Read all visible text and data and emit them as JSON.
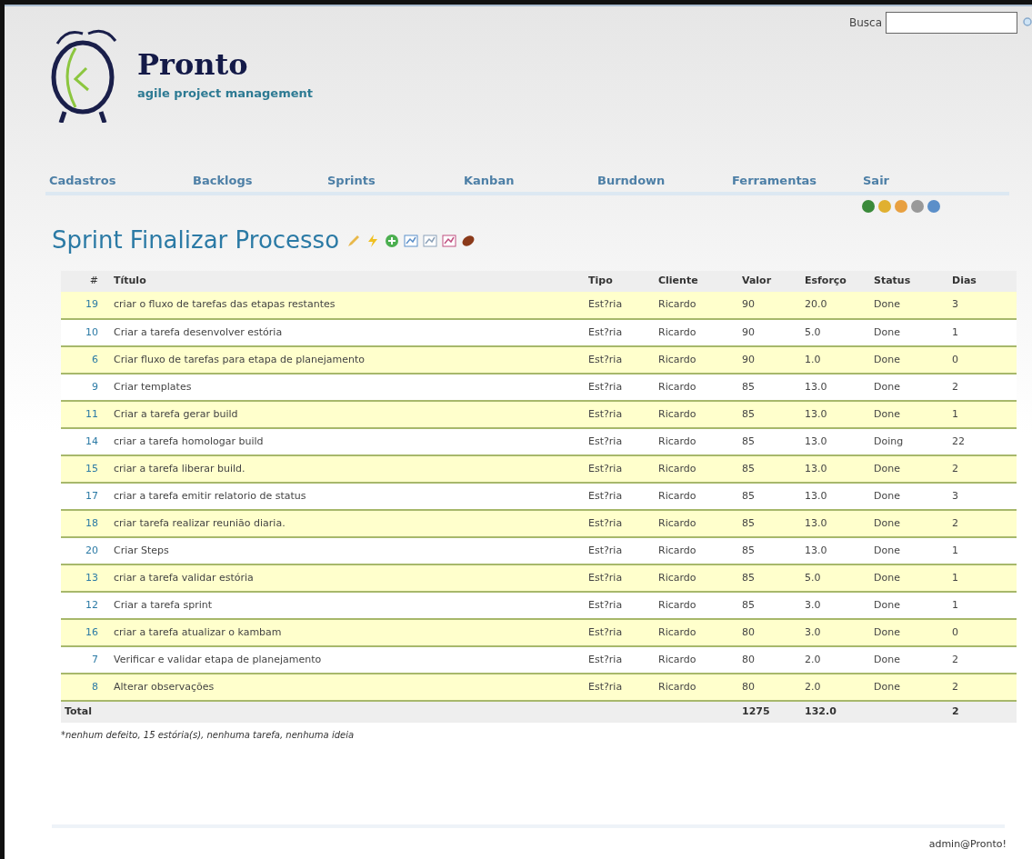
{
  "search": {
    "label": "Busca"
  },
  "logo": {
    "name": "Pronto",
    "tagline": "agile project management"
  },
  "nav": [
    "Cadastros",
    "Backlogs",
    "Sprints",
    "Kanban",
    "Burndown",
    "Ferramentas",
    "Sair"
  ],
  "title": "Sprint Finalizar Processo",
  "table": {
    "columns": [
      "#",
      "Título",
      "Tipo",
      "Cliente",
      "Valor",
      "Esforço",
      "Status",
      "Dias"
    ],
    "rows": [
      [
        "19",
        "criar o fluxo de tarefas das etapas restantes",
        "Est?ria",
        "Ricardo",
        "90",
        "20.0",
        "Done",
        "3"
      ],
      [
        "10",
        "Criar a tarefa desenvolver estória",
        "Est?ria",
        "Ricardo",
        "90",
        "5.0",
        "Done",
        "1"
      ],
      [
        "6",
        "Criar fluxo de tarefas para etapa de planejamento",
        "Est?ria",
        "Ricardo",
        "90",
        "1.0",
        "Done",
        "0"
      ],
      [
        "9",
        "Criar templates",
        "Est?ria",
        "Ricardo",
        "85",
        "13.0",
        "Done",
        "2"
      ],
      [
        "11",
        "Criar a tarefa gerar build",
        "Est?ria",
        "Ricardo",
        "85",
        "13.0",
        "Done",
        "1"
      ],
      [
        "14",
        "criar a tarefa homologar build",
        "Est?ria",
        "Ricardo",
        "85",
        "13.0",
        "Doing",
        "22"
      ],
      [
        "15",
        "criar a tarefa liberar build.",
        "Est?ria",
        "Ricardo",
        "85",
        "13.0",
        "Done",
        "2"
      ],
      [
        "17",
        "criar a tarefa emitir relatorio de status",
        "Est?ria",
        "Ricardo",
        "85",
        "13.0",
        "Done",
        "3"
      ],
      [
        "18",
        "criar tarefa realizar reunião diaria.",
        "Est?ria",
        "Ricardo",
        "85",
        "13.0",
        "Done",
        "2"
      ],
      [
        "20",
        "Criar Steps",
        "Est?ria",
        "Ricardo",
        "85",
        "13.0",
        "Done",
        "1"
      ],
      [
        "13",
        "criar a tarefa validar estória",
        "Est?ria",
        "Ricardo",
        "85",
        "5.0",
        "Done",
        "1"
      ],
      [
        "12",
        "Criar a tarefa sprint",
        "Est?ria",
        "Ricardo",
        "85",
        "3.0",
        "Done",
        "1"
      ],
      [
        "16",
        "criar a tarefa atualizar o kambam",
        "Est?ria",
        "Ricardo",
        "80",
        "3.0",
        "Done",
        "0"
      ],
      [
        "7",
        "Verificar e validar etapa de planejamento",
        "Est?ria",
        "Ricardo",
        "80",
        "2.0",
        "Done",
        "2"
      ],
      [
        "8",
        "Alterar observações",
        "Est?ria",
        "Ricardo",
        "80",
        "2.0",
        "Done",
        "2"
      ]
    ],
    "total": {
      "label": "Total",
      "valor": "1275",
      "esforco": "132.0",
      "dias": "2"
    }
  },
  "summary": "*nenhum defeito, 15 estória(s), nenhuma tarefa, nenhuma ideia",
  "footer": "admin@Pronto!"
}
